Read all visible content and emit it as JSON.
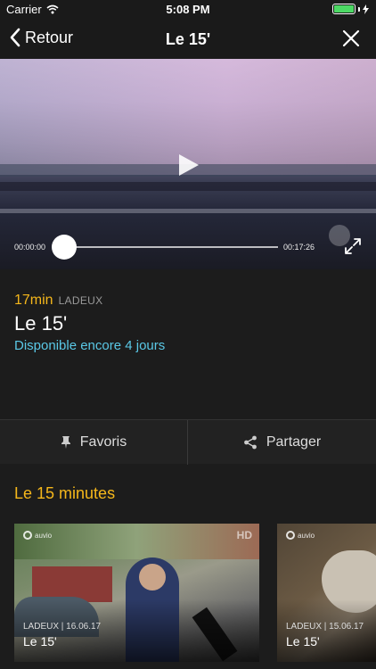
{
  "status_bar": {
    "carrier": "Carrier",
    "time": "5:08 PM",
    "battery_level": 1.0
  },
  "nav": {
    "back_label": "Retour",
    "title": "Le 15'"
  },
  "player": {
    "current_time": "00:00:00",
    "total_time": "00:17:26",
    "progress": 0.0
  },
  "episode": {
    "duration": "17min",
    "channel": "LADEUX",
    "title": "Le 15'",
    "availability": "Disponible encore 4 jours"
  },
  "actions": {
    "favorites_label": "Favoris",
    "share_label": "Partager"
  },
  "related": {
    "section_title": "Le 15 minutes",
    "items": [
      {
        "meta": "LADEUX | 16.06.17",
        "title": "Le 15'",
        "logo": "auvio",
        "badge": "HD"
      },
      {
        "meta": "LADEUX | 15.06.17",
        "title": "Le 15'",
        "logo": "auvio"
      }
    ]
  },
  "colors": {
    "accent": "#f5b71b",
    "link": "#5ac8e6",
    "background": "#1c1c1c"
  }
}
